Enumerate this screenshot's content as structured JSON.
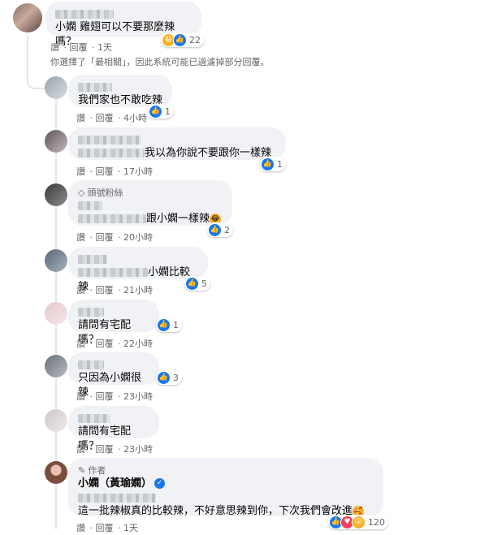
{
  "root": {
    "text": "小嫻 雞翅可以不要那麼辣嗎？",
    "actions": [
      "讚",
      "回覆",
      "1天"
    ],
    "reactions": {
      "icons": [
        "haha-icon",
        "like-icon"
      ],
      "count": "22"
    },
    "filter_note": "你選擇了「最相關」，因此系統可能已過濾掉部分回覆。"
  },
  "replies": [
    {
      "text": "我們家也不敢吃辣",
      "actions": [
        "讚",
        "回覆",
        "4小時"
      ],
      "reactions": {
        "count": "1"
      }
    },
    {
      "text": "我以為你說不要跟你一樣辣",
      "actions": [
        "讚",
        "回覆",
        "17小時"
      ],
      "reactions": {
        "count": "1"
      }
    },
    {
      "badge": "頭號粉絲",
      "text": "跟小嫻一樣辣",
      "actions": [
        "讚",
        "回覆",
        "20小時"
      ],
      "reactions": {
        "count": "2"
      }
    },
    {
      "text": "小嫻比較辣",
      "actions": [
        "讚",
        "回覆",
        "21小時"
      ],
      "reactions": {
        "count": "5"
      }
    },
    {
      "text": "請問有宅配嗎？",
      "actions": [
        "讚",
        "回覆",
        "22小時"
      ],
      "reactions": {
        "count": "1"
      }
    },
    {
      "text": "只因為小嫻很辣",
      "actions": [
        "讚",
        "回覆",
        "23小時"
      ],
      "reactions": {
        "count": "3"
      }
    },
    {
      "text": "請問有宅配嗎？",
      "actions": [
        "讚",
        "回覆",
        "23小時"
      ]
    },
    {
      "badge": "作者",
      "author": "小嫻（黃瑜嫻）",
      "text": "這一批辣椒真的比較辣，不好意思辣到你，下次我們會改進",
      "actions": [
        "讚",
        "回覆",
        "1天"
      ],
      "reactions": {
        "count": "120"
      }
    }
  ],
  "colors": {
    "bubble": "#f0f2f5",
    "like": "#1877f2",
    "meta": "#65676b",
    "line": "#e4e6eb"
  }
}
